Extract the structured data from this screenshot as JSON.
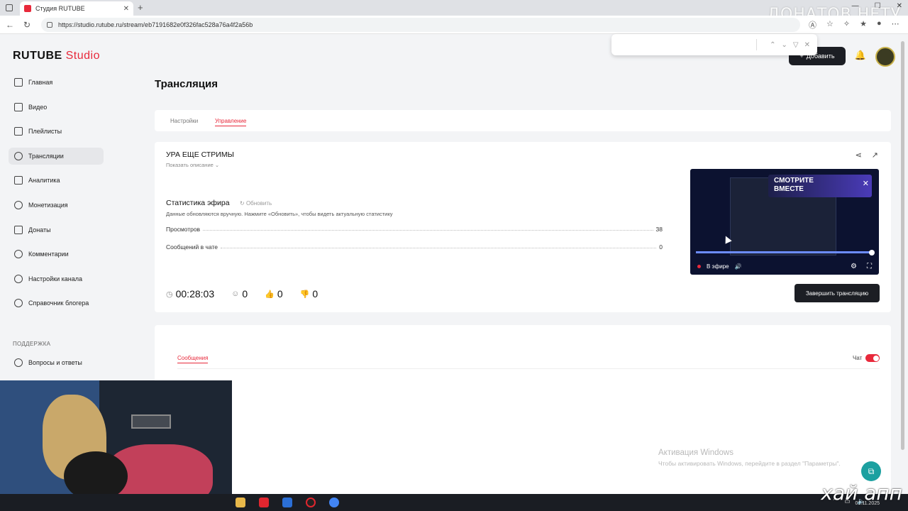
{
  "browser": {
    "tab_title": "Студия RUTUBE",
    "url": "https://studio.rutube.ru/stream/eb7191682e0f326fac528a76a4f2a56b",
    "new_tab": "+"
  },
  "overlay": {
    "top_text": "ДОНАТОВ НЕТУ",
    "bottom_text": "хай апп"
  },
  "header": {
    "logo_main": "RUTUBE",
    "logo_studio": "Studio",
    "add_button": "Добавить"
  },
  "sidebar": {
    "items": [
      {
        "label": "Главная",
        "icon": "home-icon"
      },
      {
        "label": "Видео",
        "icon": "video-icon"
      },
      {
        "label": "Плейлисты",
        "icon": "playlist-icon"
      },
      {
        "label": "Трансляции",
        "icon": "broadcast-icon"
      },
      {
        "label": "Аналитика",
        "icon": "analytics-icon"
      },
      {
        "label": "Монетизация",
        "icon": "monetization-icon"
      },
      {
        "label": "Донаты",
        "icon": "donate-icon"
      },
      {
        "label": "Комментарии",
        "icon": "comments-icon"
      },
      {
        "label": "Настройки канала",
        "icon": "settings-icon"
      },
      {
        "label": "Справочник блогера",
        "icon": "info-icon"
      }
    ],
    "support_heading": "ПОДДЕРЖКА",
    "faq": "Вопросы и ответы"
  },
  "main": {
    "page_title": "Трансляция",
    "tabs": [
      {
        "label": "Настройки"
      },
      {
        "label": "Управление"
      }
    ],
    "stream": {
      "title": "УРА ЕЩЕ СТРИМЫ",
      "show_description": "Показать описание ⌄",
      "stats_title": "Статистика эфира",
      "refresh": "Обновить",
      "stats_note": "Данные обновляются вручную. Нажмите «Обновить», чтобы видеть актуальную статистику",
      "views_label": "Просмотров",
      "views_value": "38",
      "messages_label": "Сообщений в чате",
      "messages_value": "0",
      "duration": "00:28:03",
      "viewers": "0",
      "likes": "0",
      "dislikes": "0",
      "end_button": "Завершить трансляцию"
    },
    "player": {
      "promo_line1": "СМОТРИТЕ",
      "promo_line2": "ВМЕСТЕ",
      "live_label": "В эфире",
      "progress": 0.99
    },
    "chat": {
      "tab_label": "Сообщения",
      "toggle_label": "Чат"
    }
  },
  "windows": {
    "activation_title": "Активация Windows",
    "activation_text": "Чтобы активировать Windows, перейдите в раздел \"Параметры\"."
  },
  "taskbar": {
    "clock": "01.11.2025"
  },
  "colors": {
    "accent": "#e8293b",
    "dark_button": "#1c1e24"
  }
}
